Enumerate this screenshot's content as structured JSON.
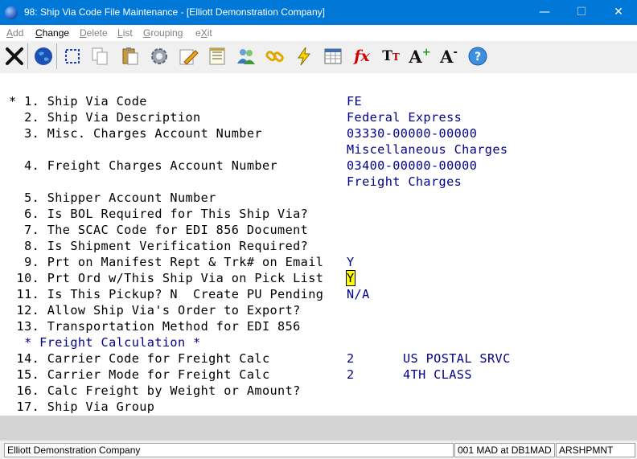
{
  "window": {
    "title": "98: Ship Via Code File Maintenance - [Elliott Demonstration Company]"
  },
  "menu": [
    {
      "label": "Add",
      "underline": "A",
      "rest": "dd",
      "enabled": false
    },
    {
      "label": "Change",
      "underline": "C",
      "rest": "hange",
      "enabled": true
    },
    {
      "label": "Delete",
      "underline": "D",
      "rest": "elete",
      "enabled": false
    },
    {
      "label": "List",
      "underline": "L",
      "rest": "ist",
      "enabled": false
    },
    {
      "label": "Grouping",
      "underline": "G",
      "rest": "rouping",
      "enabled": false
    },
    {
      "label": "eXit",
      "underline": "X",
      "pre": "e",
      "rest": "it",
      "enabled": false
    }
  ],
  "toolbar": [
    "close-icon",
    "globe-icon",
    "select-icon",
    "copy-icon",
    "paste-icon",
    "settings-icon",
    "edit-icon",
    "notes-icon",
    "users-icon",
    "link-icon",
    "lightning-icon",
    "spreadsheet-icon",
    "function-icon",
    "text-size-icon",
    "font-increase-icon",
    "font-decrease-icon",
    "help-icon"
  ],
  "fields": {
    "f1": {
      "label": "* 1. Ship Via Code",
      "value": "FE"
    },
    "f2": {
      "label": "  2. Ship Via Description",
      "value": "Federal Express"
    },
    "f3": {
      "label": "  3. Misc. Charges Account Number",
      "value": "03330-00000-00000",
      "desc": "Miscellaneous Charges"
    },
    "f4": {
      "label": "  4. Freight Charges Account Number",
      "value": "03400-00000-00000",
      "desc": "Freight Charges"
    },
    "f5": {
      "label": "  5. Shipper Account Number"
    },
    "f6": {
      "label": "  6. Is BOL Required for This Ship Via?"
    },
    "f7": {
      "label": "  7. The SCAC Code for EDI 856 Document"
    },
    "f8": {
      "label": "  8. Is Shipment Verification Required?"
    },
    "f9": {
      "label": "  9. Prt on Manifest Rept & Trk# on Email",
      "value": "Y"
    },
    "f10": {
      "label": " 10. Prt Ord w/This Ship Via on Pick List",
      "value": "Y"
    },
    "f11": {
      "label": " 11. Is This Pickup? N  Create PU Pending",
      "value": "N/A"
    },
    "f12": {
      "label": " 12. Allow Ship Via's Order to Export?"
    },
    "f13": {
      "label": " 13. Transportation Method for EDI 856"
    },
    "section": "  * Freight Calculation *",
    "f14": {
      "label": " 14. Carrier Code for Freight Calc",
      "value": "2",
      "desc": "US POSTAL SRVC"
    },
    "f15": {
      "label": " 15. Carrier Mode for Freight Calc",
      "value": "2",
      "desc": "4TH CLASS"
    },
    "f16": {
      "label": " 16. Calc Freight by Weight or Amount?"
    },
    "f17": {
      "label": " 17. Ship Via Group"
    }
  },
  "status": {
    "company": "Elliott Demonstration Company",
    "session": "001 MAD at DB1MAD",
    "program": "ARSHPMNT"
  }
}
